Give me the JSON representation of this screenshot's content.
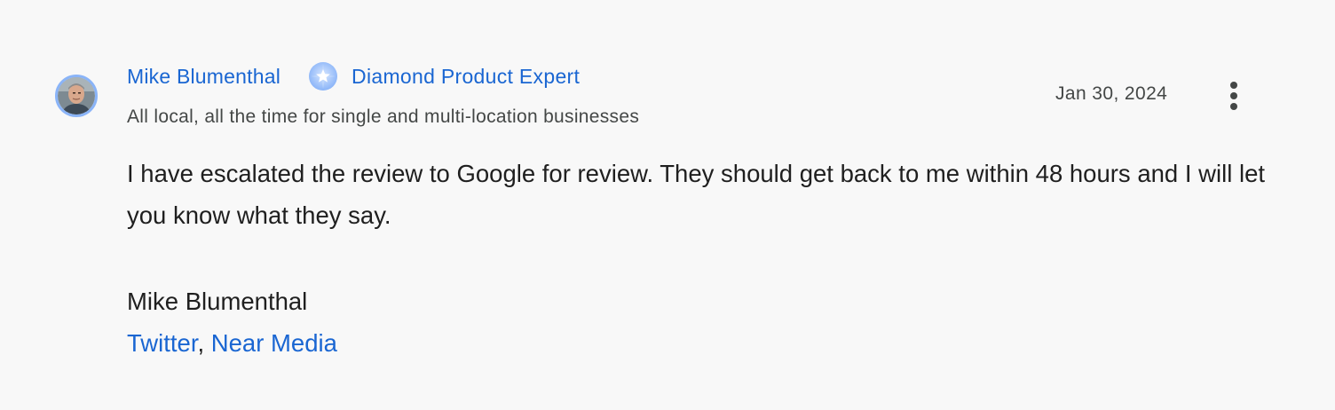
{
  "author": {
    "name": "Mike Blumenthal",
    "badge_label": "Diamond Product Expert",
    "bio": "All local, all the time for single and multi-location businesses",
    "avatar_icon": "user-avatar-photo",
    "badge_icon": "diamond-star-badge-icon"
  },
  "post": {
    "date": "Jan 30, 2024",
    "more_icon": "more-vert-icon",
    "body": "I have escalated the review to Google for review. They should get back to me within 48 hours and I will let you know what they say.",
    "signature_name": "Mike Blumenthal",
    "links": [
      {
        "label": "Twitter"
      },
      {
        "label": "Near Media"
      }
    ],
    "link_separator": ", "
  },
  "colors": {
    "background": "#f8f8f8",
    "link": "#1a66d2",
    "text": "#1f1f1f",
    "secondary_text": "#444746",
    "avatar_ring": "#8ab4f8"
  }
}
